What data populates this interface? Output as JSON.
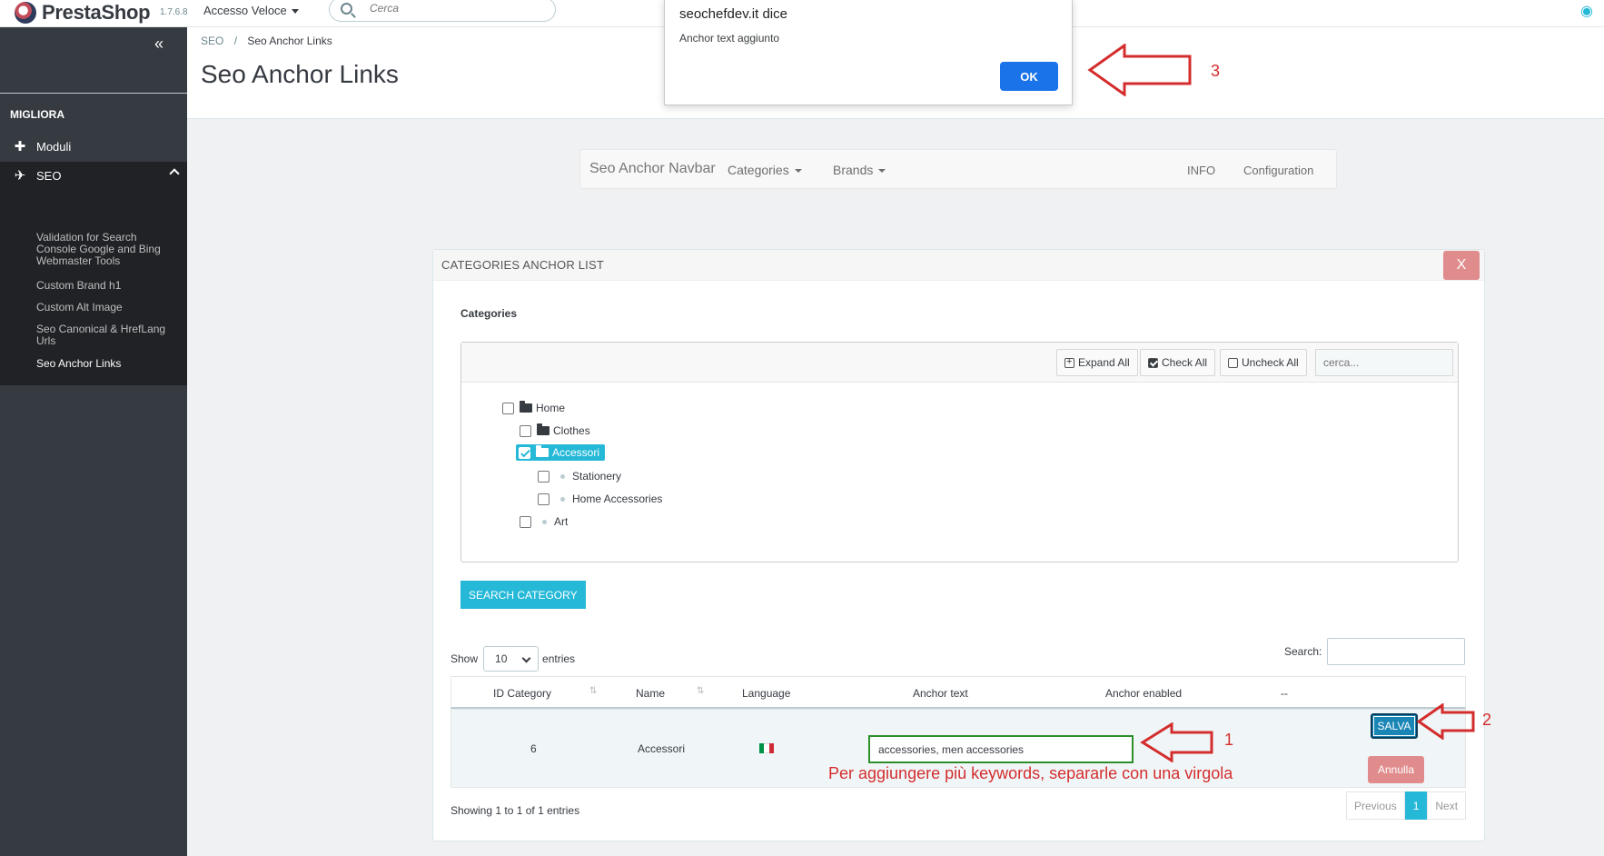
{
  "header": {
    "logo_text": "PrestaShop",
    "version": "1.7.6.8",
    "quick_access": "Accesso Veloce",
    "search_placeholder": "Cerca"
  },
  "sidebar": {
    "section": "MIGLIORA",
    "items": [
      {
        "label": "Moduli",
        "icon": "puzzle-icon"
      },
      {
        "label": "SEO",
        "icon": "plane-icon"
      }
    ],
    "subitems": [
      "Validation for Search Console Google and Bing Webmaster Tools",
      "Custom Brand h1",
      "Custom Alt Image",
      "Seo Canonical & HrefLang Urls",
      "Seo Anchor Links"
    ]
  },
  "breadcrumb": {
    "parent": "SEO",
    "separator": "/",
    "current": "Seo Anchor Links"
  },
  "page_title": "Seo Anchor Links",
  "dialog": {
    "host": "seochefdev.it dice",
    "message": "Anchor text aggiunto",
    "ok": "OK"
  },
  "navbar": {
    "brand": "Seo Anchor Navbar",
    "categories": "Categories",
    "brands": "Brands",
    "info": "INFO",
    "configuration": "Configuration"
  },
  "panel": {
    "title": "CATEGORIES ANCHOR LIST",
    "close": "X",
    "categories_label": "Categories",
    "toolbar": {
      "expand_all": "Expand All",
      "check_all": "Check All",
      "uncheck_all": "Uncheck All",
      "search_placeholder": "cerca..."
    },
    "tree": [
      {
        "label": "Home",
        "checked": false
      },
      {
        "label": "Clothes",
        "checked": false
      },
      {
        "label": "Accessori",
        "checked": true
      },
      {
        "label": "Stationery",
        "checked": false
      },
      {
        "label": "Home Accessories",
        "checked": false
      },
      {
        "label": "Art",
        "checked": false
      }
    ],
    "search_category": "SEARCH CATEGORY"
  },
  "datatable": {
    "show_label": "Show",
    "length_value": "10",
    "entries_label": "entries",
    "search_label": "Search:",
    "columns": [
      "ID Category",
      "Name",
      "Language",
      "Anchor text",
      "Anchor enabled",
      "--"
    ],
    "rows": [
      {
        "id": "6",
        "name": "Accessori",
        "language": "it",
        "anchor_text": "accessories, men accessories"
      }
    ],
    "save": "SALVA",
    "cancel": "Annulla",
    "info": "Showing 1 to 1 of 1 entries",
    "pagination": {
      "previous": "Previous",
      "current": "1",
      "next": "Next"
    }
  },
  "annotations": {
    "arrow_1": "1",
    "arrow_2": "2",
    "arrow_3": "3",
    "note": "Per aggiungere più keywords, separarle con una virgola",
    "color": "#d42d2d"
  },
  "colors": {
    "accent": "#25b9d7",
    "sidebar": "#363a41",
    "danger": "#e08c8c",
    "dialog_button": "#1a73e8"
  }
}
